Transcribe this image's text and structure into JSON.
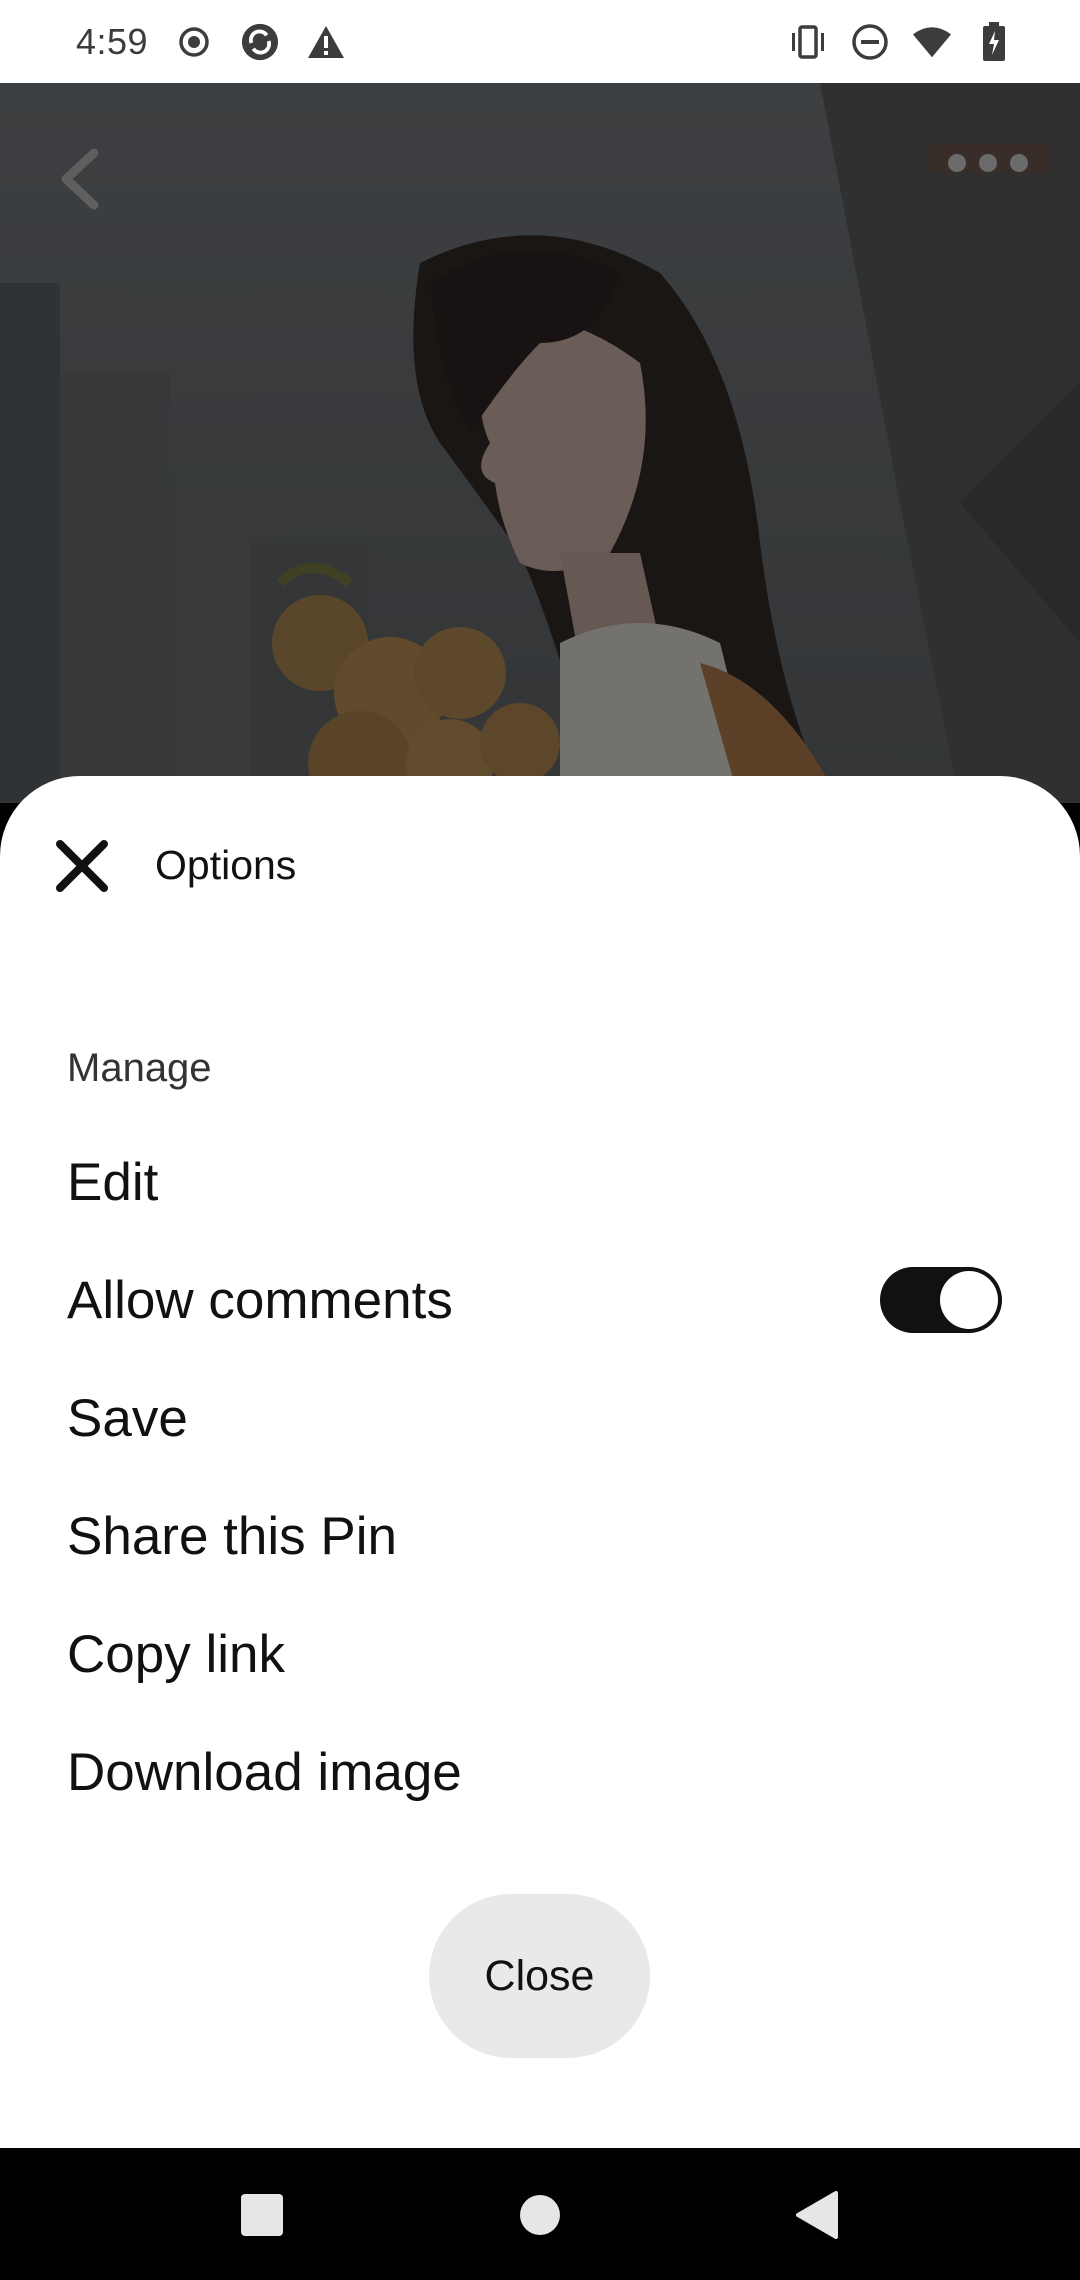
{
  "status_bar": {
    "time": "4:59",
    "left_icons": [
      "record-icon",
      "sync-app-icon",
      "alert-triangle-icon"
    ],
    "right_icons": [
      "vibrate-icon",
      "do-not-disturb-icon",
      "wifi-icon",
      "battery-charging-icon"
    ]
  },
  "pin": {
    "image_alt": "",
    "back_icon": "chevron-left-icon",
    "more_icon": "more-horizontal-icon"
  },
  "sheet": {
    "title": "Options",
    "close_icon": "close-x-icon",
    "section_label": "Manage",
    "items": [
      {
        "label": "Edit"
      },
      {
        "label": "Allow comments",
        "toggle": true,
        "toggle_on": true
      },
      {
        "label": "Save"
      },
      {
        "label": "Share this Pin"
      },
      {
        "label": "Copy link"
      },
      {
        "label": "Download image"
      }
    ],
    "close_button_label": "Close"
  },
  "nav_bar": {
    "icons": [
      "recents-square-icon",
      "home-circle-icon",
      "back-triangle-icon"
    ]
  },
  "colors": {
    "sheet_bg": "#ffffff",
    "text_primary": "#111111",
    "toggle_on": "#111111",
    "close_button_bg": "#e9e9e9",
    "nav_bar_bg": "#000000"
  }
}
